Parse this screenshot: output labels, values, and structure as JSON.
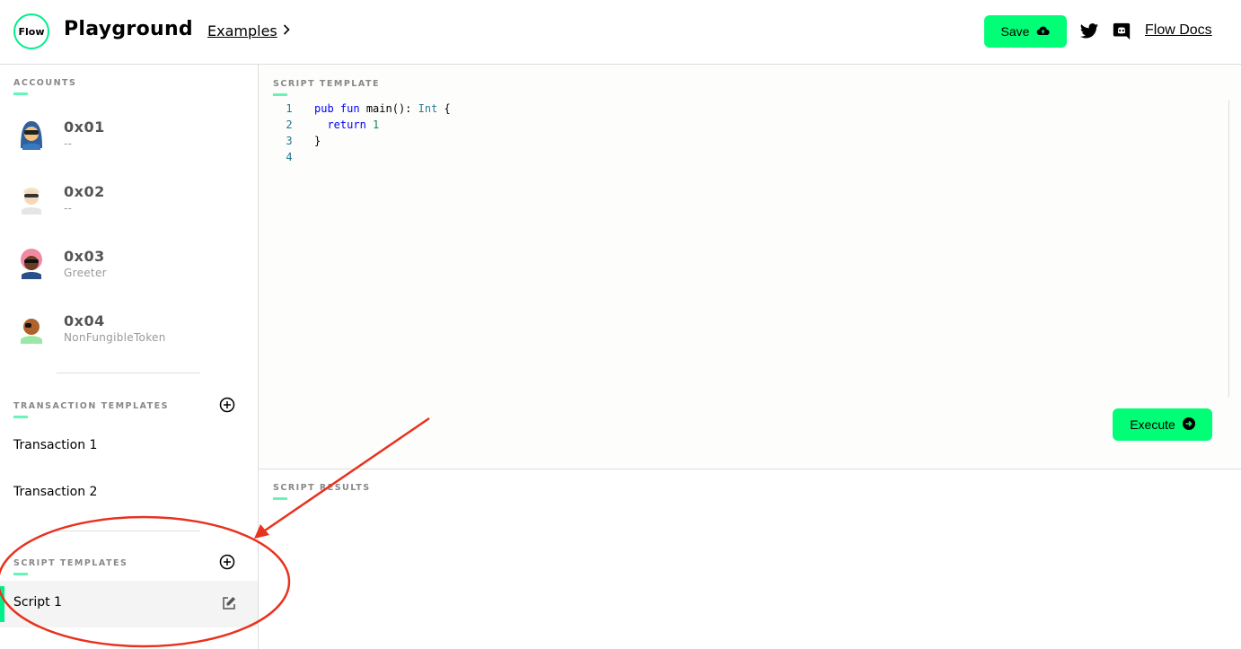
{
  "header": {
    "logo_text": "Flow",
    "title": "Playground",
    "examples_label": "Examples",
    "save_label": "Save",
    "docs_label": "Flow Docs",
    "icons": [
      "flow-logo-icon",
      "chevron-right-icon",
      "cloud-upload-icon",
      "twitter-icon",
      "discord-icon"
    ]
  },
  "sidebar": {
    "accounts_label": "ACCOUNTS",
    "accounts": [
      {
        "address": "0x01",
        "contract": "--"
      },
      {
        "address": "0x02",
        "contract": "--"
      },
      {
        "address": "0x03",
        "contract": "Greeter"
      },
      {
        "address": "0x04",
        "contract": "NonFungibleToken"
      }
    ],
    "transaction_templates_label": "TRANSACTION TEMPLATES",
    "transactions": [
      "Transaction 1",
      "Transaction 2"
    ],
    "script_templates_label": "SCRIPT TEMPLATES",
    "scripts": [
      "Script 1"
    ]
  },
  "editor": {
    "label": "SCRIPT TEMPLATE",
    "line_numbers": [
      "1",
      "2",
      "3",
      "4"
    ],
    "execute_label": "Execute"
  },
  "results": {
    "label": "SCRIPT RESULTS"
  },
  "colors": {
    "accent": "#00ef8b",
    "button": "#00ff76",
    "annotation": "#e8321e"
  }
}
